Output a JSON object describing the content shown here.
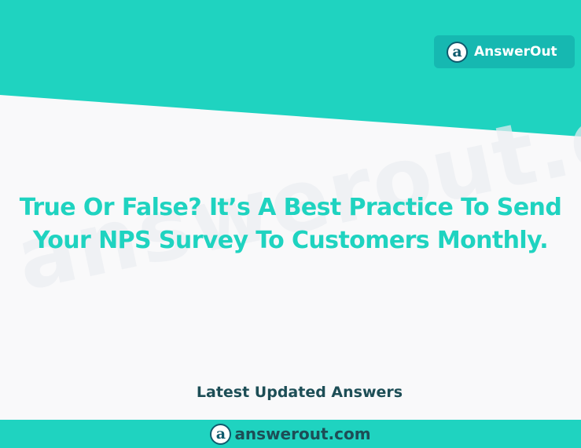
{
  "brand": {
    "name": "AnswerOut",
    "logo_letter": "a",
    "icon": "answerout-logo-icon"
  },
  "headline": {
    "line1": "True Or False? It’s A Best Practice To Send",
    "line2": "Your NPS Survey To Customers Monthly."
  },
  "watermark": "answerout.com",
  "subtitle": "Latest Updated Answers",
  "footer": {
    "domain": "answerout.com",
    "logo_letter": "a",
    "icon": "answerout-logo-icon"
  },
  "colors": {
    "teal": "#1fd3c0",
    "dark_teal": "#16b8b1",
    "navy": "#1d4e56",
    "background": "#f9f9fa"
  }
}
